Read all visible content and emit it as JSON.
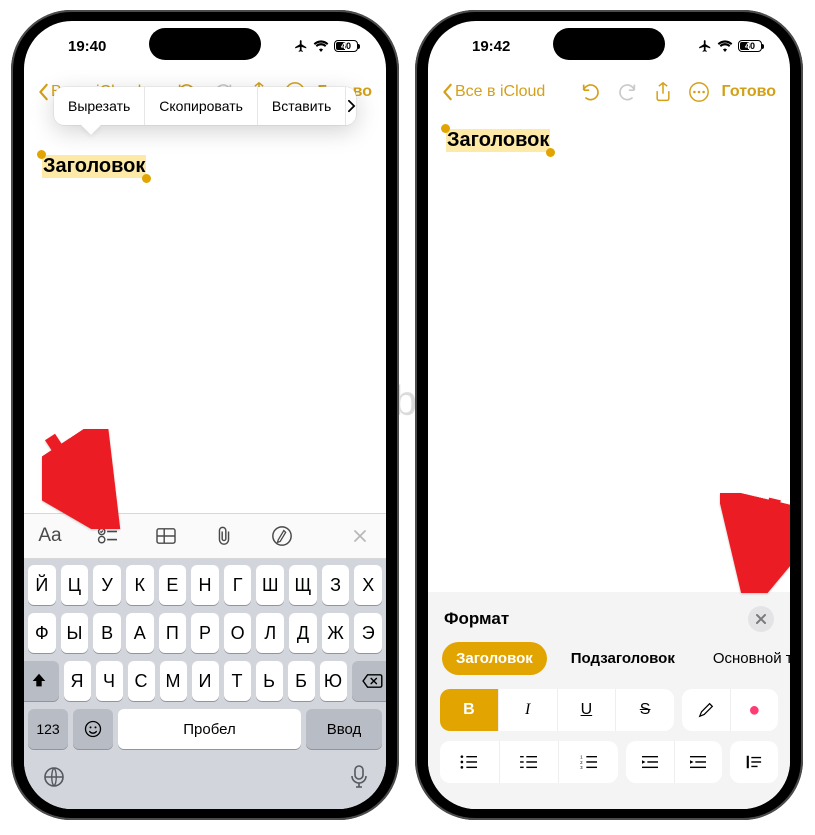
{
  "watermark": "Yablyk",
  "statusbar": {
    "time_left": "19:40",
    "time_right": "19:42",
    "battery": "40"
  },
  "nav": {
    "back": "Все в iCloud",
    "done": "Готово"
  },
  "context_menu": {
    "cut": "Вырезать",
    "copy": "Скопировать",
    "paste": "Вставить"
  },
  "note": {
    "heading": "Заголовок"
  },
  "keyboard": {
    "acc_aa": "Aa",
    "row1": [
      "Й",
      "Ц",
      "У",
      "К",
      "Е",
      "Н",
      "Г",
      "Ш",
      "Щ",
      "З",
      "Х"
    ],
    "row2": [
      "Ф",
      "Ы",
      "В",
      "А",
      "П",
      "Р",
      "О",
      "Л",
      "Д",
      "Ж",
      "Э"
    ],
    "row3": [
      "Я",
      "Ч",
      "С",
      "М",
      "И",
      "Т",
      "Ь",
      "Б",
      "Ю"
    ],
    "num": "123",
    "space": "Пробел",
    "enter": "Ввод"
  },
  "format": {
    "title": "Формат",
    "styles": {
      "heading": "Заголовок",
      "subheading": "Подзаголовок",
      "body": "Основной текст"
    },
    "bold": "B",
    "italic": "I",
    "underline": "U",
    "strike": "S"
  }
}
